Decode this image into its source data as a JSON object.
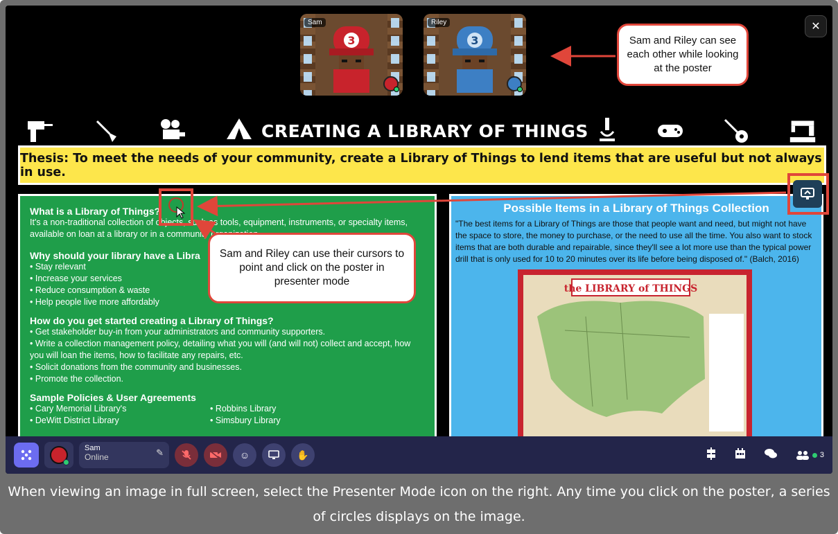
{
  "tiles": [
    {
      "name": "Sam",
      "color": "#c8232c"
    },
    {
      "name": "Riley",
      "color": "#3d7fc4"
    }
  ],
  "callouts": {
    "top": "Sam and Riley can see each other while looking at the poster",
    "middle": "Sam and Riley can use their cursors to point and click on the poster in presenter mode"
  },
  "poster": {
    "title": "CREATING A LIBRARY OF THINGS",
    "thesis": "Thesis: To meet the needs of your community, create a Library of Things to lend items that are useful but not always in use.",
    "left": {
      "what_heading": "What is a Library of Things?",
      "what_text": "It's a non-traditional collection of objects, such as tools, equipment, instruments, or specialty items, available on loan at a library or in a community organization.",
      "why_heading": "Why should your library have a Libra",
      "why_items": [
        "Stay relevant",
        "Increase your services",
        "Reduce consumption & waste",
        "Help people live more affordably"
      ],
      "how_heading": "How do you get started creating a Library of Things?",
      "how_items": [
        "Get stakeholder buy-in from your administrators and community supporters.",
        "Write a collection management policy, detailing what you will (and will not) collect and accept, how you will loan the items, how to facilitate any repairs, etc.",
        "Solicit donations from the community and businesses.",
        "Promote the collection."
      ],
      "sample_heading": "Sample Policies & User Agreements",
      "sample_left": [
        "Cary Memorial Library's",
        "DeWitt District Library"
      ],
      "sample_right": [
        "Robbins Library",
        "Simsbury Library"
      ]
    },
    "right": {
      "heading": "Possible Items in a Library of Things Collection",
      "quote": "\"The best items for a Library of Things are those that people want and need, but might not have the space to store, the money to purchase, or the need to use all the time. You also want to stock items that are both durable and repairable, since they'll see a lot more use than the typical power drill that is only used for 10 to 20 minutes over its life before being disposed of.\" (Balch, 2016)",
      "map_title": "the LIBRARY of THINGS"
    }
  },
  "bottombar": {
    "user_name": "Sam",
    "user_status": "Online",
    "participant_count": "3"
  },
  "caption": "When viewing an image in full screen, select the Presenter Mode icon on the right. Any time you click on the poster, a series of circles displays on the image.",
  "colors": {
    "accent": "#e0463a",
    "thesis_bg": "#fde64b",
    "green_panel": "#1f9e4a",
    "blue_panel": "#4cb5ec"
  }
}
